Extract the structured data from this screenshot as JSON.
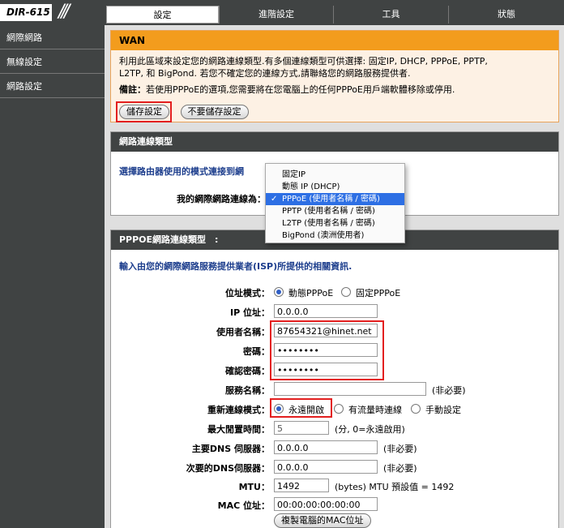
{
  "brand": "DIR-615",
  "tabs": [
    {
      "label": "設定",
      "active": true
    },
    {
      "label": "進階設定",
      "active": false
    },
    {
      "label": "工具",
      "active": false
    },
    {
      "label": "狀態",
      "active": false
    }
  ],
  "sidebar": {
    "items": [
      "網際網路",
      "無線設定",
      "網路設定"
    ]
  },
  "wan": {
    "title": "WAN",
    "desc1": "利用此區域來設定您的網路連線類型.有多個連線類型可供選擇: 固定IP, DHCP, PPPoE, PPTP,",
    "desc2": "L2TP, 和 BigPond. 若您不確定您的連線方式,請聯絡您的網路服務提供者.",
    "note_label": "備註：",
    "note_text": "若使用PPPoE的選項,您需要將在您電腦上的任何PPPoE用戶端軟體移除或停用.",
    "save_label": "儲存設定",
    "nosave_label": "不要儲存設定"
  },
  "connection": {
    "title": "網路連線類型",
    "select_prompt": "選擇路由器使用的模式連接到網",
    "my_connection_label": "我的網際網路連線為：",
    "options": [
      "固定IP",
      "動態 IP (DHCP)",
      "PPPoE (使用者名稱 / 密碼)",
      "PPTP (使用者名稱 / 密碼)",
      "L2TP (使用者名稱 / 密碼)",
      "BigPond (澳洲使用者)"
    ],
    "selected_index": 2
  },
  "pppoe": {
    "title": "PPPOE網路連線類型　:",
    "intro": "輸入由您的網際網路服務提供業者(ISP)所提供的相關資訊.",
    "address_mode_label": "位址模式：",
    "address_mode_dynamic": "動態PPPoE",
    "address_mode_static": "固定PPPoE",
    "ip_label": "IP 位址：",
    "ip_value": "0.0.0.0",
    "username_label": "使用者名稱：",
    "username_value": "87654321@hinet.net",
    "password_label": "密碼：",
    "password_value": "••••••••",
    "confirm_label": "確認密碼：",
    "confirm_value": "••••••••",
    "service_label": "服務名稱：",
    "service_value": "",
    "optional": "(非必要)",
    "reconnect_label": "重新連線模式：",
    "reconnect_always": "永遠開啟",
    "reconnect_ondemand": "有流量時連線",
    "reconnect_manual": "手動設定",
    "idle_label": "最大閒置時間：",
    "idle_value": "5",
    "idle_hint": "(分, 0=永遠啟用)",
    "dns1_label": "主要DNS 伺服器：",
    "dns1_value": "0.0.0.0",
    "dns2_label": "次要的DNS伺服器：",
    "dns2_value": "0.0.0.0",
    "mtu_label": "MTU：",
    "mtu_value": "1492",
    "mtu_hint": "(bytes) MTU 預設值 = 1492",
    "mac_label": "MAC 位址：",
    "mac_value": "00:00:00:00:00:00",
    "clone_mac_label": "複製電腦的MAC位址"
  }
}
